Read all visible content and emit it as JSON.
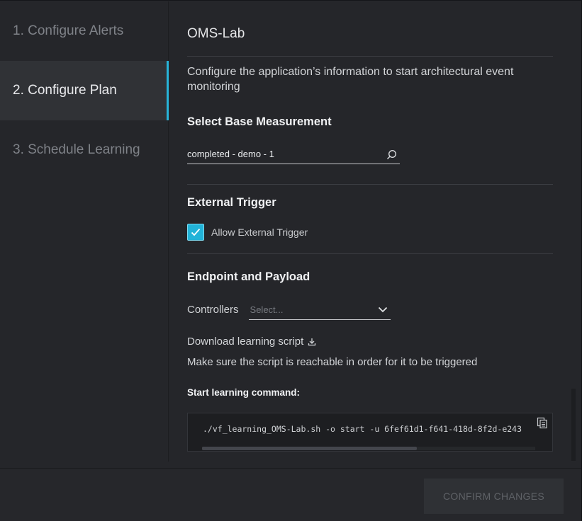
{
  "sidebar": {
    "steps": [
      {
        "label": "1. Configure Alerts"
      },
      {
        "label": "2. Configure Plan"
      },
      {
        "label": "3. Schedule Learning"
      }
    ]
  },
  "main": {
    "app_title": "OMS-Lab",
    "description": "Configure the application’s information to start architectural event monitoring",
    "base_measurement": {
      "heading": "Select Base Measurement",
      "value": "completed - demo - 1"
    },
    "external_trigger": {
      "heading": "External Trigger",
      "checkbox_label": "Allow External Trigger",
      "checked": true
    },
    "endpoint": {
      "heading": "Endpoint and Payload",
      "controllers_label": "Controllers",
      "controllers_placeholder": "Select...",
      "download_label": "Download learning script",
      "note": "Make sure the script is reachable in order for it to be triggered",
      "command_label": "Start learning command:",
      "command": "./vf_learning_OMS-Lab.sh -o start -u 6fef61d1-f641-418d-8f2d-e243"
    }
  },
  "footer": {
    "confirm_label": "CONFIRM CHANGES"
  },
  "colors": {
    "accent": "#27b4d9",
    "background": "#25262a"
  }
}
